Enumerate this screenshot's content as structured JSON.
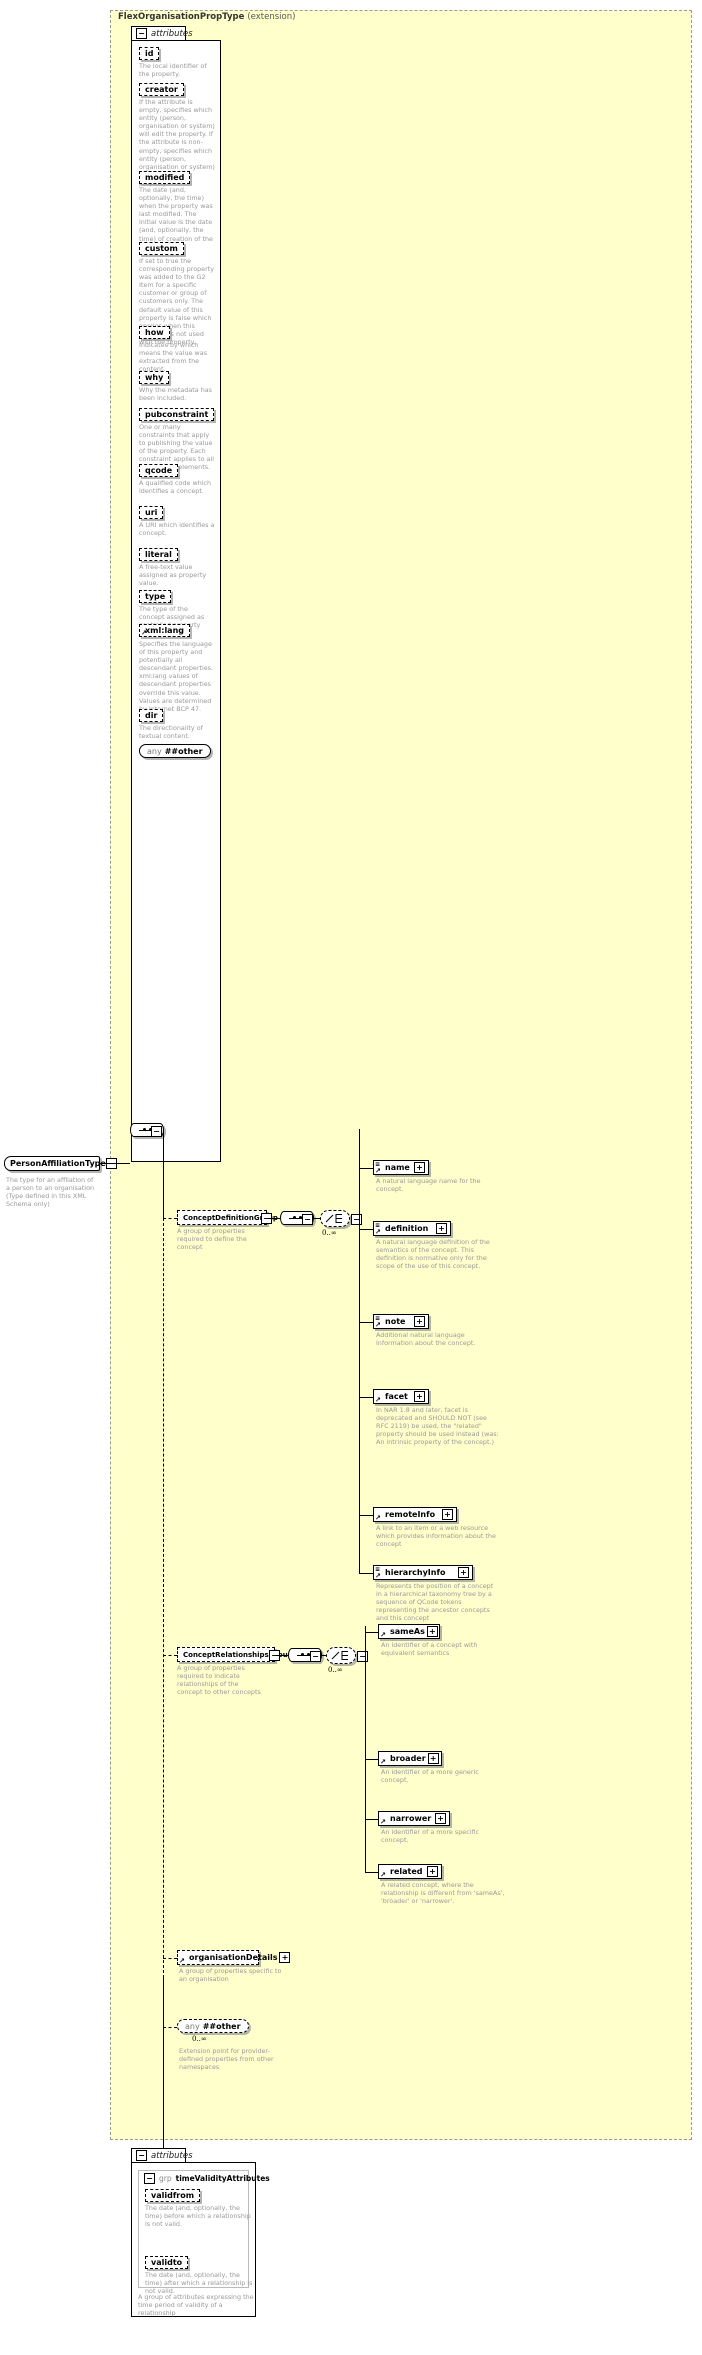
{
  "diagram": {
    "title": "FlexOrganisationPropType",
    "title_suffix": "(extension)",
    "attributes_label": "attributes",
    "root": {
      "name": "PersonAffiliationType",
      "desc": "The type for an affliation of a person to an organisation (Type defined in this XML Schema only)"
    },
    "any_other": {
      "prefix": "any",
      "name": "##other"
    },
    "any_other_ext": {
      "prefix": "any",
      "name": "##other",
      "cardinality": "0..∞",
      "desc": "Extension point for provider-defined properties from other namespaces"
    },
    "cardinality": "0..∞",
    "toggles": {
      "minus": "−",
      "plus": "+"
    }
  },
  "attributes": [
    {
      "name": "id",
      "desc": "The local identifier of the property."
    },
    {
      "name": "creator",
      "desc": "If the attribute is empty, specifies which entity (person, organisation or system) will edit the property. If the attribute is non-empty, specifies which entity (person, organisation or system) has edited the property."
    },
    {
      "name": "modified",
      "desc": "The date (and, optionally, the time) when the property was last modified. The initial value is the date (and, optionally, the time) of creation of the property."
    },
    {
      "name": "custom",
      "desc": "If set to true the corresponding property was added to the G2 Item for a specific customer or group of customers only. The default value of this property is false which applies when this attribute is not used with the property."
    },
    {
      "name": "how",
      "desc": "Indicates by which means the value was extracted from the content."
    },
    {
      "name": "why",
      "desc": "Why the metadata has been included."
    },
    {
      "name": "pubconstraint",
      "desc": "One or many constraints that apply to publishing the value of the property. Each constraint applies to all descendant elements."
    },
    {
      "name": "qcode",
      "desc": "A qualified code which identifies a concept."
    },
    {
      "name": "uri",
      "desc": "A URI which identifies a concept."
    },
    {
      "name": "literal",
      "desc": "A free-text value assigned as property value."
    },
    {
      "name": "type",
      "desc": "The type of the concept assigned as controlled property value."
    },
    {
      "name": "xml:lang",
      "desc": "Specifies the language of this property and potentially all descendant properties. xml:lang values of descendant properties override this value. Values are determined by Internet BCP 47."
    },
    {
      "name": "dir",
      "desc": "The directionality of textual content."
    }
  ],
  "groups": {
    "concept_definition": {
      "name": "ConceptDefinitionGroup",
      "desc": "A group of properties required to define the concept",
      "members": [
        {
          "name": "name",
          "desc": "A natural language name for the concept."
        },
        {
          "name": "definition",
          "desc": "A natural language definition of the semantics of the concept. This definition is normative only for the scope of the use of this concept."
        },
        {
          "name": "note",
          "desc": "Additional natural language information about the concept."
        },
        {
          "name": "facet",
          "desc": "In NAR 1.8 and later, facet is deprecated and SHOULD NOT (see RFC 2119) be used, the \"related\" property should be used instead (was: An intrinsic property of the concept.)"
        },
        {
          "name": "remoteInfo",
          "desc": "A link to an item or a web resource which provides information about the concept"
        },
        {
          "name": "hierarchyInfo",
          "desc": "Represents the position of a concept in a hierarchical taxonomy tree by a sequence of QCode tokens representing the ancestor concepts and this concept"
        }
      ]
    },
    "concept_relationships": {
      "name": "ConceptRelationshipsGroup",
      "desc": "A group of properties required to indicate relationships of the concept to other concepts",
      "members": [
        {
          "name": "sameAs",
          "desc": "An identifier of a concept with equivalent semantics"
        },
        {
          "name": "broader",
          "desc": "An identifier of a more generic concept."
        },
        {
          "name": "narrower",
          "desc": "An identifier of a more specific concept."
        },
        {
          "name": "related",
          "desc": "A related concept, where the relationship is different from 'sameAs', 'broader' or 'narrower'."
        }
      ]
    },
    "organisation_details": {
      "name": "organisationDetails",
      "desc": "A group of properties specific to an organisation"
    }
  },
  "time_validity": {
    "attributes_label": "attributes",
    "grp_prefix": "grp",
    "name": "timeValidityAttributes",
    "desc": "A group of attributes expressing the time period of validity of a relationship",
    "members": [
      {
        "name": "validfrom",
        "desc": "The date (and, optionally, the time) before which a relationship is not valid."
      },
      {
        "name": "validto",
        "desc": "The date (and, optionally, the time) after which a relationship is not valid."
      }
    ]
  }
}
